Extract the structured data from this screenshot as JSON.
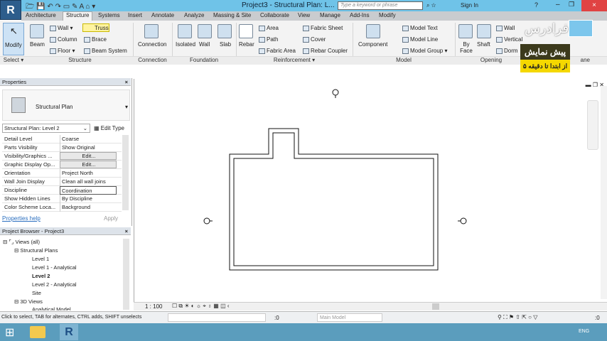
{
  "app": {
    "logo": "R",
    "title": "Project3 - Structural Plan: L...",
    "search_placeholder": "Type a keyword or phrase",
    "sign_in": "Sign In"
  },
  "tabs": [
    "Architecture",
    "Structure",
    "Systems",
    "Insert",
    "Annotate",
    "Analyze",
    "Massing & Site",
    "Collaborate",
    "View",
    "Manage",
    "Add-Ins",
    "Modify"
  ],
  "ribbon": {
    "modify": "Modify",
    "beam": "Beam",
    "wall": "Wall",
    "column": "Column",
    "floor": "Floor",
    "truss": "Truss",
    "brace": "Brace",
    "beam_system": "Beam System",
    "connection": "Connection",
    "isolated": "Isolated",
    "fwall": "Wall",
    "slab": "Slab",
    "rebar": "Rebar",
    "area": "Area",
    "path": "Path",
    "fabric_area": "Fabric Area",
    "fabric_sheet": "Fabric Sheet",
    "cover": "Cover",
    "rebar_coupler": "Rebar Coupler",
    "component": "Component",
    "model_text": "Model Text",
    "model_line": "Model Line",
    "model_group": "Model Group",
    "by_face": "By Face",
    "shaft": "Shaft",
    "owall": "Wall",
    "vertical": "Vertical",
    "dormer": "Dorm",
    "panels": {
      "select": "Select ▾",
      "structure": "Structure",
      "connection": "Connection",
      "foundation": "Foundation",
      "reinforcement": "Reinforcement ▾",
      "model": "Model",
      "opening": "Opening",
      "plane": "ane"
    }
  },
  "watermark": {
    "brand": "فرادرس",
    "line1": "پیش نمایش",
    "line2": "از ابتدا تا دقیقه ۵"
  },
  "properties": {
    "title": "Properties",
    "type_name": "Structural Plan",
    "selector": "Structural Plan: Level 2",
    "edit_type": "Edit Type",
    "rows": [
      {
        "k": "Detail Level",
        "v": "Coarse"
      },
      {
        "k": "Parts Visibility",
        "v": "Show Original"
      },
      {
        "k": "Visibility/Graphics ...",
        "v": "Edit..."
      },
      {
        "k": "Graphic Display Op...",
        "v": "Edit..."
      },
      {
        "k": "Orientation",
        "v": "Project North"
      },
      {
        "k": "Wall Join Display",
        "v": "Clean all wall joins"
      },
      {
        "k": "Discipline",
        "v": "Coordination"
      },
      {
        "k": "Show Hidden Lines",
        "v": "By Discipline"
      },
      {
        "k": "Color Scheme Loca...",
        "v": "Background"
      }
    ],
    "help": "Properties help",
    "apply": "Apply"
  },
  "browser": {
    "title": "Project Browser - Project3",
    "items": [
      "Views (all)",
      "Structural Plans",
      "Level 1",
      "Level 1 - Analytical",
      "Level 2",
      "Level 2 - Analytical",
      "Site",
      "3D Views",
      "Analytical Model"
    ]
  },
  "viewbar": {
    "scale": "1 : 100"
  },
  "status": {
    "hint": "Click to select, TAB for alternates, CTRL adds, SHIFT unselects",
    "count": ":0",
    "model": "Main Model",
    "filter": ":0"
  },
  "taskbar": {
    "lang": "ENG"
  }
}
